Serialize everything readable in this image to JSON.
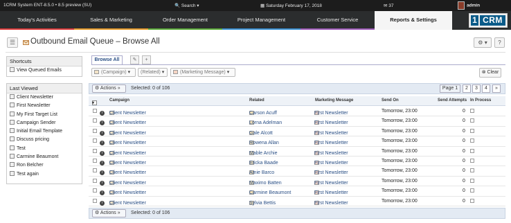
{
  "topbar": {
    "system": "1CRM System ENT-8.5.0 • 8.5 preview (SU)",
    "search": "Search ▾",
    "date": "Saturday February 17, 2018",
    "mail_count": "37",
    "user": "admin"
  },
  "nav": {
    "tabs": [
      {
        "label": "Today's Activities",
        "color": "#d93a3a"
      },
      {
        "label": "Sales & Marketing",
        "color": "#e59a2a"
      },
      {
        "label": "Order Management",
        "color": "#5aaa3a"
      },
      {
        "label": "Project Management",
        "color": "#3a8fd0"
      },
      {
        "label": "Customer Service",
        "color": "#9b59b6"
      },
      {
        "label": "Reports & Settings",
        "color": "#dddddd"
      }
    ],
    "logo_one": "1",
    "logo_crm": "CRM"
  },
  "page": {
    "title": "Outbound Email Queue – Browse All"
  },
  "shortcuts": {
    "header": "Shortcuts",
    "items": [
      "View Queued Emails"
    ]
  },
  "last_viewed": {
    "header": "Last Viewed",
    "items": [
      "Client Newsletter",
      "First Newsletter",
      "My First Target List",
      "Campaign Sender",
      "Initial Email Template",
      "Discuss pricing",
      "Test",
      "Carmine Beaumont",
      "Ron Belcher",
      "Test again"
    ]
  },
  "list": {
    "tab_label": "Browse All",
    "filters": [
      "(Campaign)",
      "(Related)",
      "(Marketing Message)"
    ],
    "clear_label": "Clear",
    "actions_label": "Actions",
    "selected_text": "Selected: 0 of 106",
    "pages": [
      "Page 1",
      "2",
      "3",
      "4"
    ],
    "columns": {
      "campaign": "Campaign",
      "related": "Related",
      "message": "Marketing Message",
      "send_on": "Send On",
      "attempts": "Send Attempts",
      "in_process": "In Process"
    },
    "rows": [
      {
        "campaign": "Client Newsletter",
        "related": "Carson Acuff",
        "message": "First Newsletter",
        "send_on": "Tomorrow, 23:00",
        "attempts": "0"
      },
      {
        "campaign": "Client Newsletter",
        "related": "Lorna Adelman",
        "message": "First Newsletter",
        "send_on": "Tomorrow, 23:00",
        "attempts": "0"
      },
      {
        "campaign": "Client Newsletter",
        "related": "Gale Alcott",
        "message": "First Newsletter",
        "send_on": "Tomorrow, 23:00",
        "attempts": "0"
      },
      {
        "campaign": "Client Newsletter",
        "related": "Rowena Allan",
        "message": "First Newsletter",
        "send_on": "Tomorrow, 23:00",
        "attempts": "0"
      },
      {
        "campaign": "Client Newsletter",
        "related": "Mable Archie",
        "message": "First Newsletter",
        "send_on": "Tomorrow, 23:00",
        "attempts": "0"
      },
      {
        "campaign": "Client Newsletter",
        "related": "Ericka Baade",
        "message": "First Newsletter",
        "send_on": "Tomorrow, 23:00",
        "attempts": "0"
      },
      {
        "campaign": "Client Newsletter",
        "related": "Amie Barco",
        "message": "First Newsletter",
        "send_on": "Tomorrow, 23:00",
        "attempts": "0"
      },
      {
        "campaign": "Client Newsletter",
        "related": "Maximo Batten",
        "message": "First Newsletter",
        "send_on": "Tomorrow, 23:00",
        "attempts": "0"
      },
      {
        "campaign": "Client Newsletter",
        "related": "Carmine Beaumont",
        "message": "First Newsletter",
        "send_on": "Tomorrow, 23:00",
        "attempts": "0"
      },
      {
        "campaign": "Client Newsletter",
        "related": "Sylvia Bettis",
        "message": "First Newsletter",
        "send_on": "Tomorrow, 23:00",
        "attempts": "0"
      }
    ]
  }
}
